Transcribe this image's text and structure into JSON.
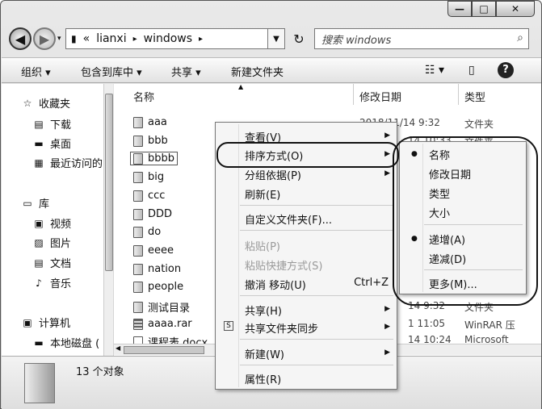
{
  "window": {
    "min_symbol": "—",
    "max_symbol": "□",
    "close_symbol": "✕"
  },
  "address": {
    "chevrons": "«",
    "path": [
      "lianxi",
      "windows"
    ],
    "sep": "▸"
  },
  "search": {
    "placeholder": "搜索 windows"
  },
  "toolbar": {
    "organize": "组织 ▾",
    "include": "包含到库中 ▾",
    "share": "共享 ▾",
    "new_folder": "新建文件夹",
    "help": "?"
  },
  "nav": {
    "favorites": "收藏夹",
    "downloads": "下载",
    "desktop": "桌面",
    "recent": "最近访问的",
    "library": "库",
    "videos": "视频",
    "pictures": "图片",
    "documents": "文档",
    "music": "音乐",
    "computer": "计算机",
    "local_disk": "本地磁盘 ("
  },
  "columns": {
    "name": "名称",
    "date": "修改日期",
    "type": "类型"
  },
  "files": [
    {
      "name": "aaa"
    },
    {
      "name": "bbb"
    },
    {
      "name": "bbbb"
    },
    {
      "name": "big"
    },
    {
      "name": "ccc"
    },
    {
      "name": "DDD"
    },
    {
      "name": "do"
    },
    {
      "name": "eeee"
    },
    {
      "name": "nation"
    },
    {
      "name": "people"
    },
    {
      "name": "测试目录"
    },
    {
      "name": "aaaa.rar"
    },
    {
      "name": "课程表.docx"
    }
  ],
  "meta_rows": [
    {
      "date": "2018/11/14 9:32",
      "type": "文件夹"
    },
    {
      "date": "14 10:33",
      "type": "文件夹"
    },
    {
      "date": "14 9:32",
      "type": "文件夹"
    },
    {
      "date": "1 11:05",
      "type": "WinRAR 压"
    },
    {
      "date": "14 10:24",
      "type": "Microsoft"
    }
  ],
  "status": {
    "count": "13 个对象"
  },
  "context_menu": {
    "view": "查看(V)",
    "sort": "排序方式(O)",
    "group": "分组依据(P)",
    "refresh": "刷新(E)",
    "customize": "自定义文件夹(F)...",
    "paste": "粘贴(P)",
    "paste_shortcut": "粘贴快捷方式(S)",
    "undo": "撤消 移动(U)",
    "undo_key": "Ctrl+Z",
    "share": "共享(H)",
    "sync": "共享文件夹同步",
    "new": "新建(W)",
    "properties": "属性(R)"
  },
  "sort_menu": {
    "name": "名称",
    "date": "修改日期",
    "type": "类型",
    "size": "大小",
    "asc": "递增(A)",
    "desc": "递减(D)",
    "more": "更多(M)..."
  }
}
